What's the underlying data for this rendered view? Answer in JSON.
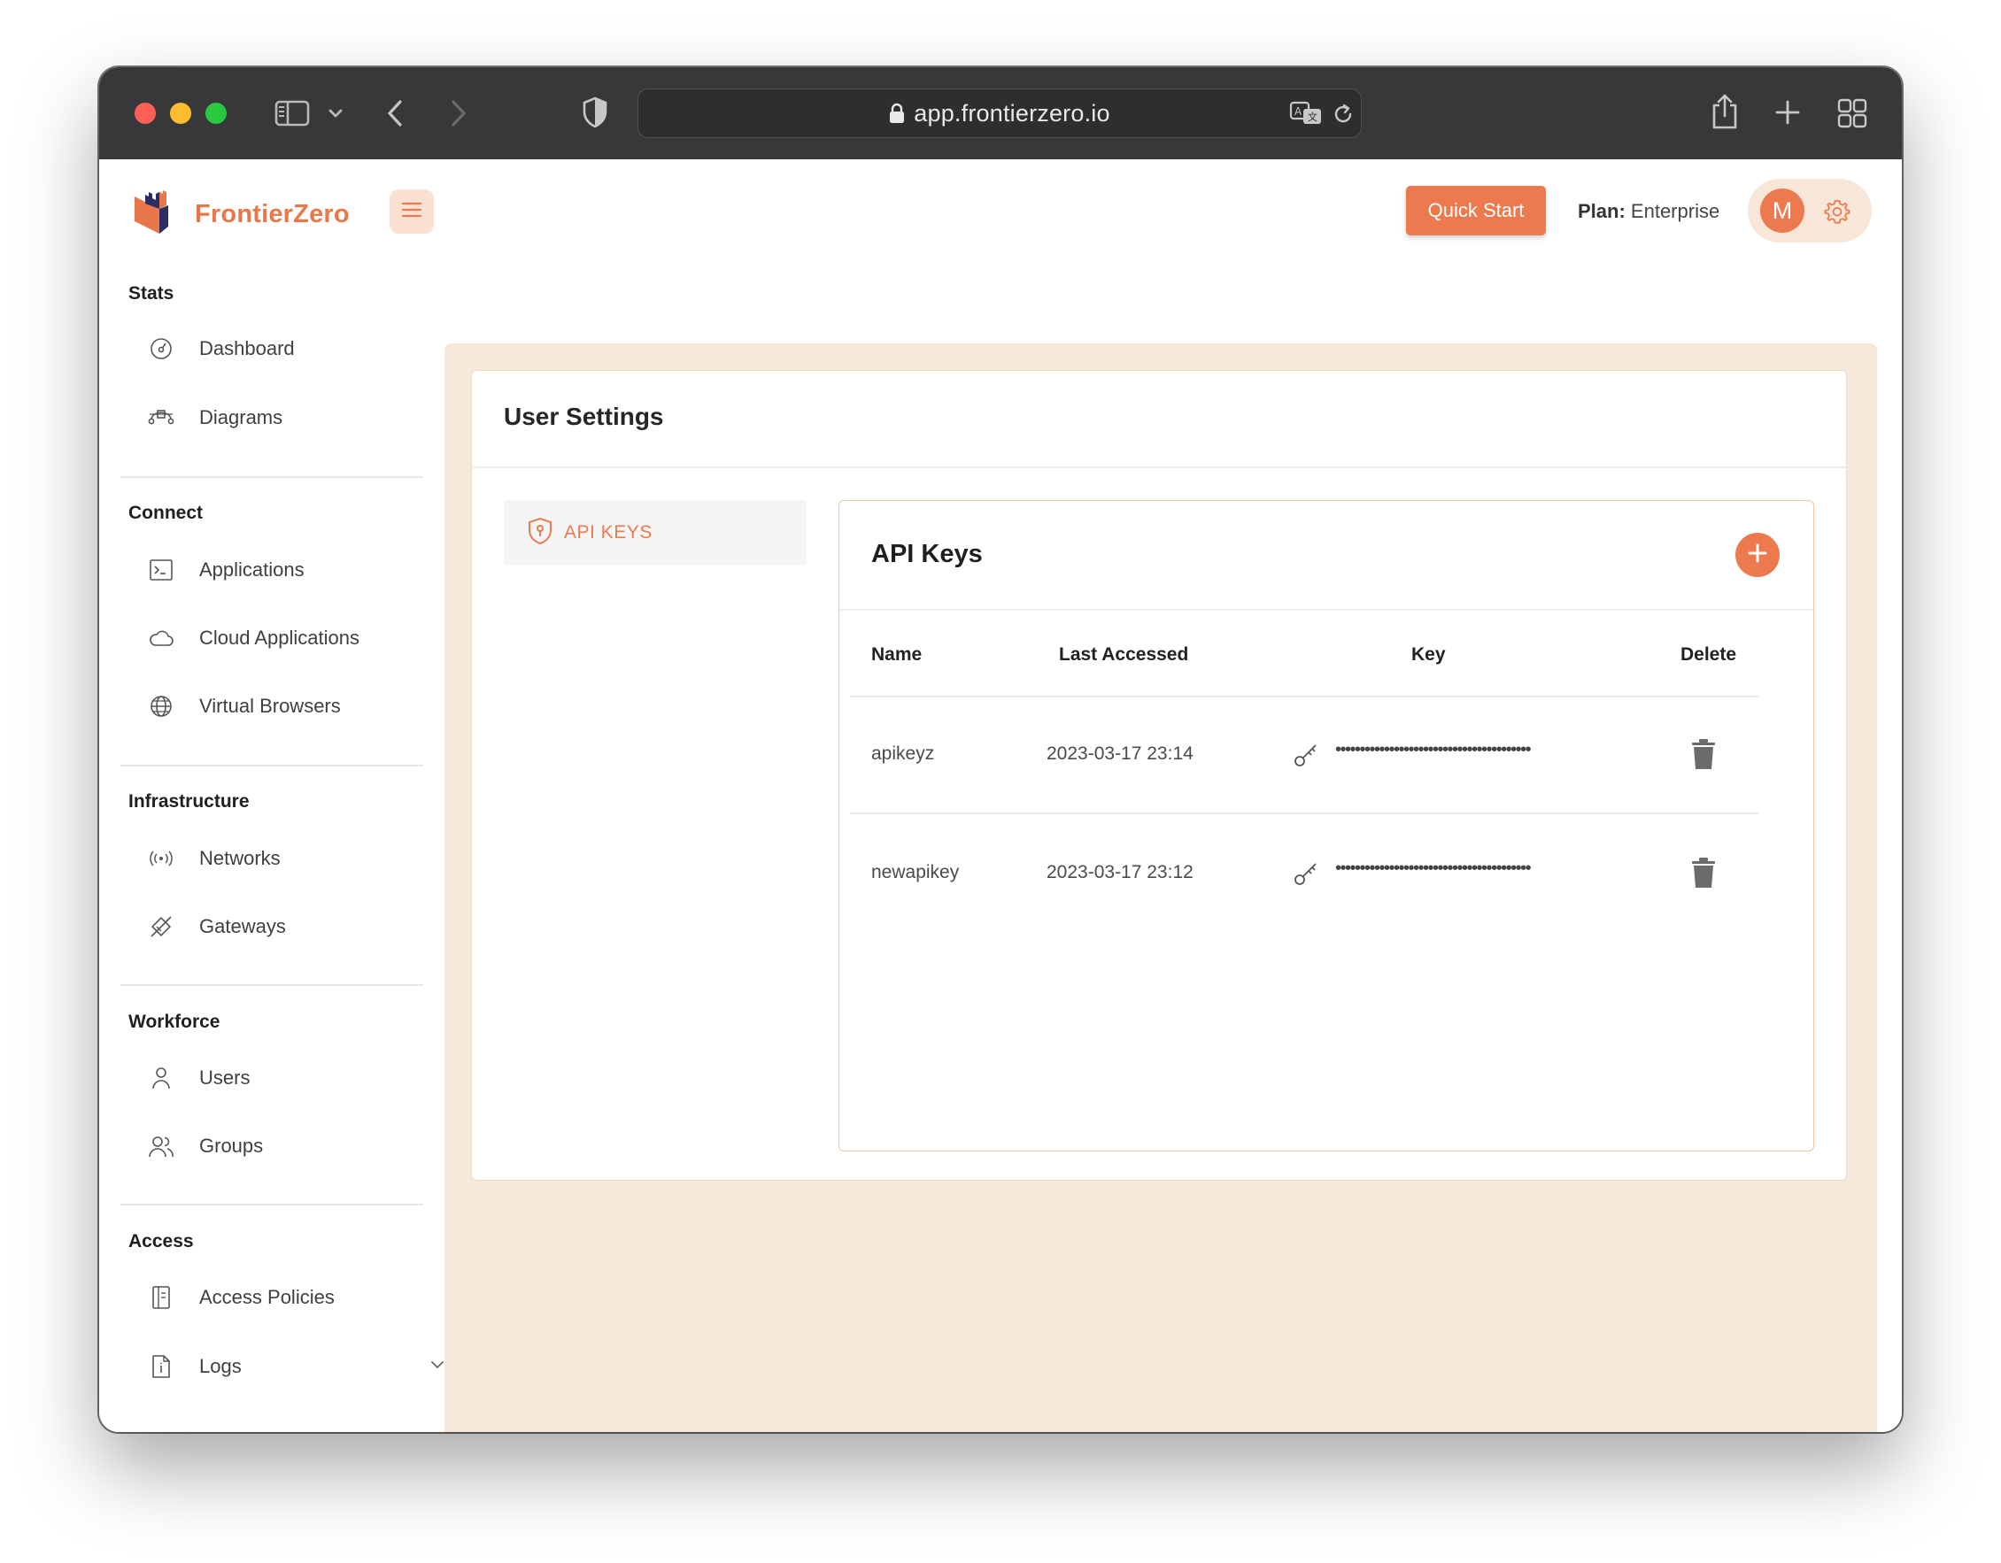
{
  "browser": {
    "url": "app.frontierzero.io"
  },
  "header": {
    "brand": "FrontierZero",
    "quick_start_label": "Quick Start",
    "plan_label": "Plan:",
    "plan_value": "Enterprise",
    "avatar_initial": "M"
  },
  "sidebar": {
    "sections": [
      {
        "title": "Stats",
        "items": [
          {
            "label": "Dashboard",
            "icon": "dashboard-icon"
          },
          {
            "label": "Diagrams",
            "icon": "diagram-icon"
          }
        ]
      },
      {
        "title": "Connect",
        "items": [
          {
            "label": "Applications",
            "icon": "terminal-icon"
          },
          {
            "label": "Cloud Applications",
            "icon": "cloud-icon"
          },
          {
            "label": "Virtual Browsers",
            "icon": "globe-icon"
          }
        ]
      },
      {
        "title": "Infrastructure",
        "items": [
          {
            "label": "Networks",
            "icon": "broadcast-icon"
          },
          {
            "label": "Gateways",
            "icon": "gateway-icon"
          }
        ]
      },
      {
        "title": "Workforce",
        "items": [
          {
            "label": "Users",
            "icon": "user-icon"
          },
          {
            "label": "Groups",
            "icon": "group-icon"
          }
        ]
      },
      {
        "title": "Access",
        "items": [
          {
            "label": "Access Policies",
            "icon": "policy-icon"
          },
          {
            "label": "Logs",
            "icon": "log-icon"
          }
        ]
      }
    ]
  },
  "settings": {
    "title": "User Settings",
    "tab_label": "API KEYS"
  },
  "api_keys": {
    "title": "API Keys",
    "columns": {
      "name": "Name",
      "last_accessed": "Last Accessed",
      "key": "Key",
      "delete": "Delete"
    },
    "rows": [
      {
        "name": "apikeyz",
        "last_accessed": "2023-03-17 23:14",
        "key_mask": "••••••••••••••••••••••••••••••••••••••••"
      },
      {
        "name": "newapikey",
        "last_accessed": "2023-03-17 23:12",
        "key_mask": "••••••••••••••••••••••••••••••••••••••••"
      }
    ]
  },
  "colors": {
    "accent": "#ec7a4e",
    "content_bg": "#f6e9dc",
    "titlebar": "#38383b"
  }
}
